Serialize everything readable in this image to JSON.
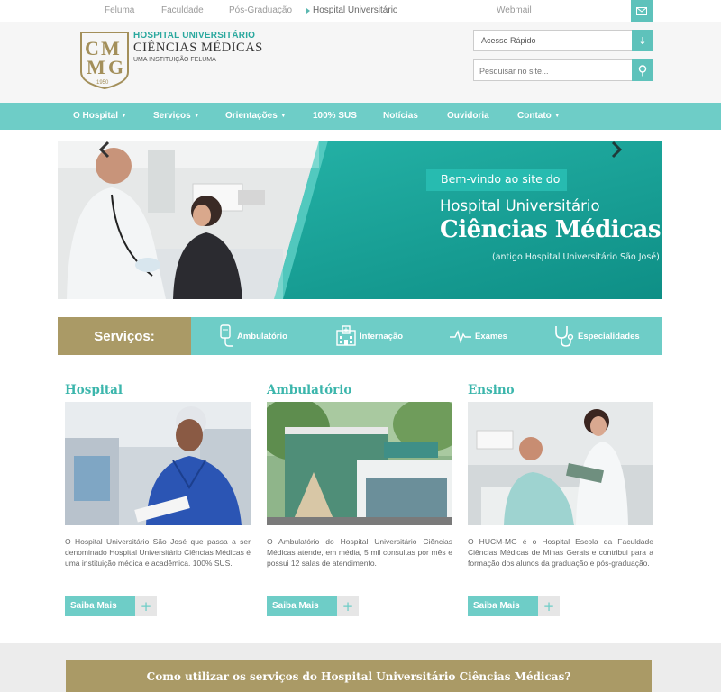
{
  "toplinks": {
    "feluma": "Feluma",
    "faculdade": "Faculdade",
    "pos": "Pós-Graduação",
    "hospital": "Hospital Universitário",
    "webmail": "Webmail"
  },
  "logo": {
    "line1": "HOSPITAL UNIVERSITÁRIO",
    "line2": "CIÊNCIAS MÉDICAS",
    "line3": "UMA INSTITUIÇÃO FELUMA",
    "seal_letters": "CMMG",
    "seal_year": "1950"
  },
  "quick_access": {
    "label": "Acesso Rápido"
  },
  "search": {
    "placeholder": "Pesquisar no site..."
  },
  "nav": {
    "items": [
      {
        "label": "O Hospital"
      },
      {
        "label": "Serviços"
      },
      {
        "label": "Orientações"
      },
      {
        "label": "100% SUS"
      },
      {
        "label": "Notícias"
      },
      {
        "label": "Ouvidoria"
      },
      {
        "label": "Contato"
      }
    ]
  },
  "hero": {
    "welcome": "Bem-vindo ao site do",
    "line1": "Hospital Universitário",
    "line2": "Ciências Médicas",
    "line3": "(antigo Hospital Universitário São José)"
  },
  "services": {
    "title": "Serviços:",
    "items": [
      {
        "label": "Ambulatório",
        "icon": "iv-drip-icon"
      },
      {
        "label": "Internação",
        "icon": "hospital-building-icon"
      },
      {
        "label": "Exames",
        "icon": "heartbeat-icon"
      },
      {
        "label": "Especialidades",
        "icon": "stethoscope-icon"
      }
    ]
  },
  "columns": [
    {
      "title": "Hospital",
      "text": "O Hospital Universitário São José que passa a ser denominado Hospital Universitário Ciências Médicas é uma instituição médica e acadêmica. 100% SUS.",
      "button": "Saiba Mais"
    },
    {
      "title": "Ambulatório",
      "text": "O Ambulatório do Hospital Universitário Ciências Médicas atende, em média, 5 mil consultas por mês e possui 12 salas de atendimento.",
      "button": "Saiba Mais"
    },
    {
      "title": "Ensino",
      "text": "O HUCM-MG é o Hospital Escola da Faculdade Ciências Médicas de Minas Gerais e contribui para a formação dos alunos da graduação e pós-graduação.",
      "button": "Saiba Mais"
    }
  ],
  "how_to": "Como utilizar os serviços do Hospital Universitário Ciências Médicas?",
  "colors": {
    "teal": "#6ecdc7",
    "teal_dark": "#17a399",
    "gold": "#aa9a66"
  }
}
